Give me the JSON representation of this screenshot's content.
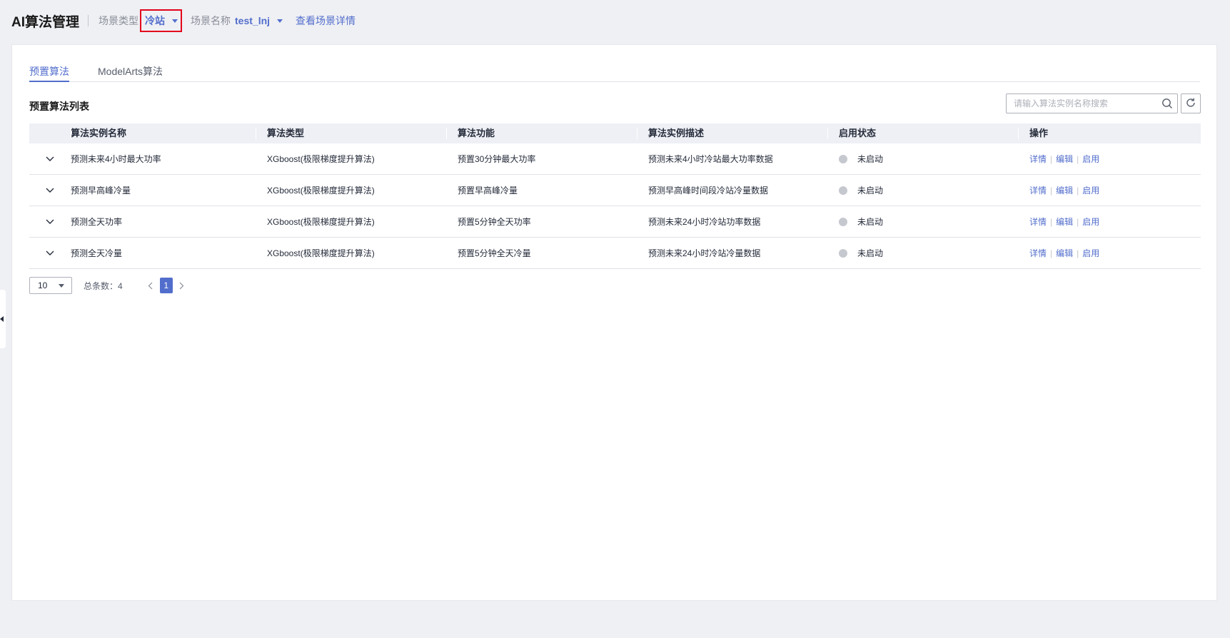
{
  "header": {
    "title": "AI算法管理",
    "scene_type_label": "场景类型",
    "scene_type_value": "冷站",
    "scene_name_label": "场景名称",
    "scene_name_value": "test_lnj",
    "detail_link": "查看场景详情"
  },
  "tabs": [
    {
      "label": "预置算法",
      "active": true
    },
    {
      "label": "ModelArts算法",
      "active": false
    }
  ],
  "list": {
    "title": "预置算法列表",
    "search_placeholder": "请输入算法实例名称搜索"
  },
  "table": {
    "columns": [
      "算法实例名称",
      "算法类型",
      "算法功能",
      "算法实例描述",
      "启用状态",
      "操作"
    ],
    "rows": [
      {
        "name": "预测未来4小时最大功率",
        "type": "XGboost(极限梯度提升算法)",
        "func": "预置30分钟最大功率",
        "desc": "预测未来4小时冷站最大功率数据",
        "status": "未启动"
      },
      {
        "name": "预测早高峰冷量",
        "type": "XGboost(极限梯度提升算法)",
        "func": "预置早高峰冷量",
        "desc": "预测早高峰时间段冷站冷量数据",
        "status": "未启动"
      },
      {
        "name": "预测全天功率",
        "type": "XGboost(极限梯度提升算法)",
        "func": "预置5分钟全天功率",
        "desc": "预测未来24小时冷站功率数据",
        "status": "未启动"
      },
      {
        "name": "预测全天冷量",
        "type": "XGboost(极限梯度提升算法)",
        "func": "预置5分钟全天冷量",
        "desc": "预测未来24小时冷站冷量数据",
        "status": "未启动"
      }
    ],
    "ops": {
      "detail": "详情",
      "edit": "编辑",
      "enable": "启用"
    }
  },
  "pagination": {
    "page_size": "10",
    "total_label": "总条数：4",
    "current_page": "1"
  },
  "colors": {
    "accent": "#526ecc",
    "highlight_border": "#e3001b",
    "status_inactive": "#c5c8cf"
  }
}
